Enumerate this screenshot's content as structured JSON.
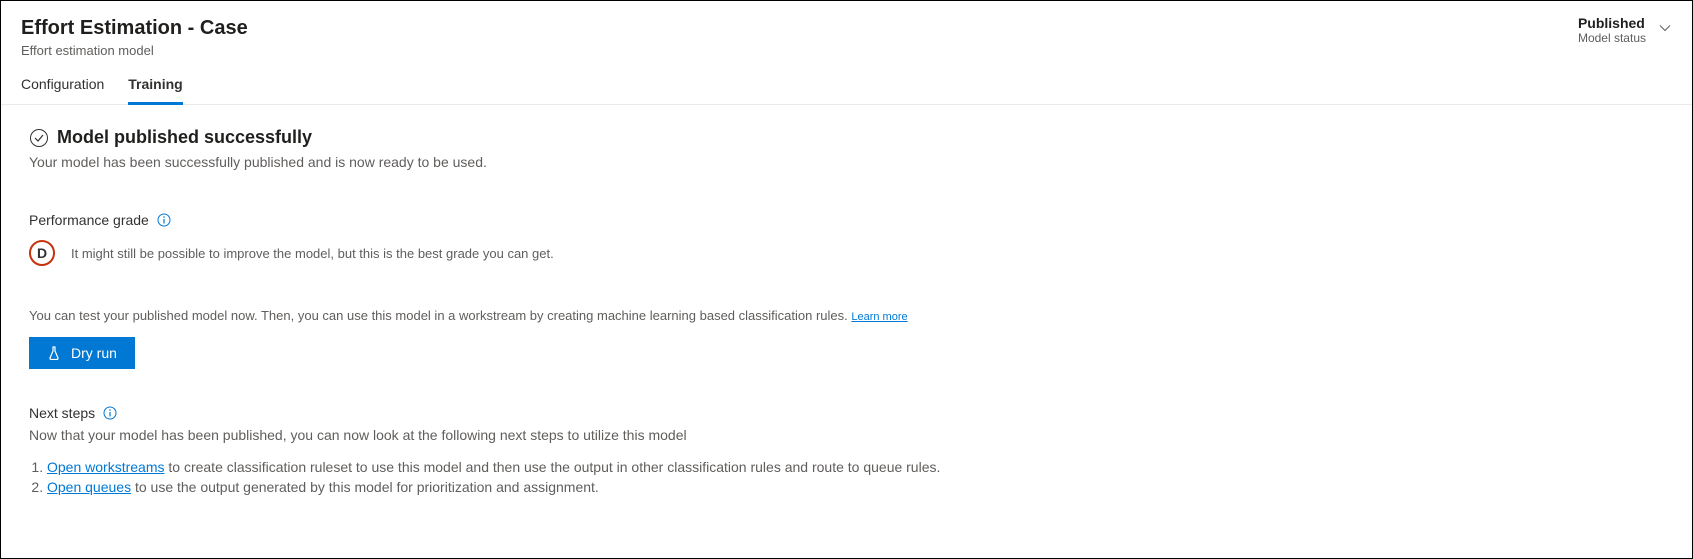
{
  "header": {
    "title": "Effort Estimation - Case",
    "subtitle": "Effort estimation model",
    "status_value": "Published",
    "status_label": "Model status"
  },
  "tabs": [
    {
      "label": "Configuration",
      "active": false
    },
    {
      "label": "Training",
      "active": true
    }
  ],
  "success": {
    "heading": "Model published successfully",
    "description": "Your model has been successfully published and is now ready to be used."
  },
  "performance": {
    "heading": "Performance grade",
    "grade_letter": "D",
    "grade_text": "It might still be possible to improve the model, but this is the best grade you can get."
  },
  "test": {
    "text": "You can test your published model now. Then, you can use this model in a workstream by creating machine learning based classification rules. ",
    "learn_more": "Learn more"
  },
  "dry_run_label": "Dry run",
  "next_steps": {
    "heading": "Next steps",
    "description": "Now that your model has been published, you can now look at the following next steps to utilize this model",
    "items": [
      {
        "link_text": "Open workstreams",
        "suffix": " to create classification ruleset to use this model and then use the output in other classification rules and route to queue rules."
      },
      {
        "link_text": "Open queues",
        "suffix": " to use the output generated by this model for prioritization and assignment."
      }
    ]
  }
}
